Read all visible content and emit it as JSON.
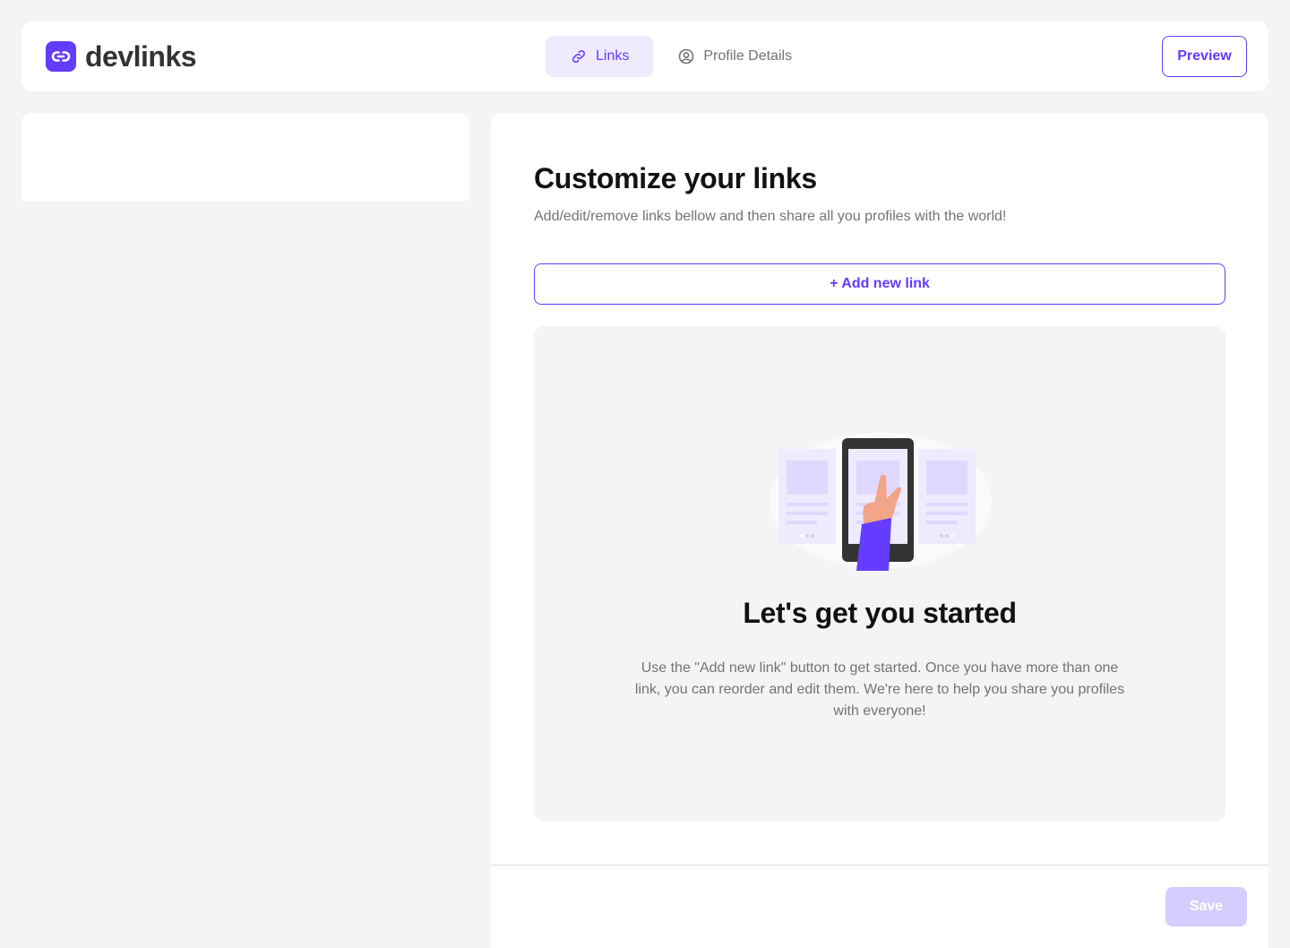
{
  "app": {
    "name": "devlinks",
    "logo_icon": "link-chain-icon",
    "accent_color": "#633cff",
    "accent_light": "#efebff",
    "disabled_accent": "#d6cdff"
  },
  "nav": {
    "tabs": [
      {
        "label": "Links",
        "icon": "link-icon",
        "active": true
      },
      {
        "label": "Profile Details",
        "icon": "user-circle-icon",
        "active": false
      }
    ],
    "preview_label": "Preview"
  },
  "main": {
    "title": "Customize your links",
    "subtitle": "Add/edit/remove links bellow and then share all you profiles with the world!",
    "add_link_label": "+ Add new link",
    "empty_state": {
      "illustration": "phone-tap-illustration",
      "title": "Let's get you started",
      "text": "Use the \"Add new link\" button to get started. Once you have more than one link, you can reorder and edit them. We're here to help you share you profiles with everyone!"
    },
    "save_label": "Save",
    "save_disabled": true
  }
}
